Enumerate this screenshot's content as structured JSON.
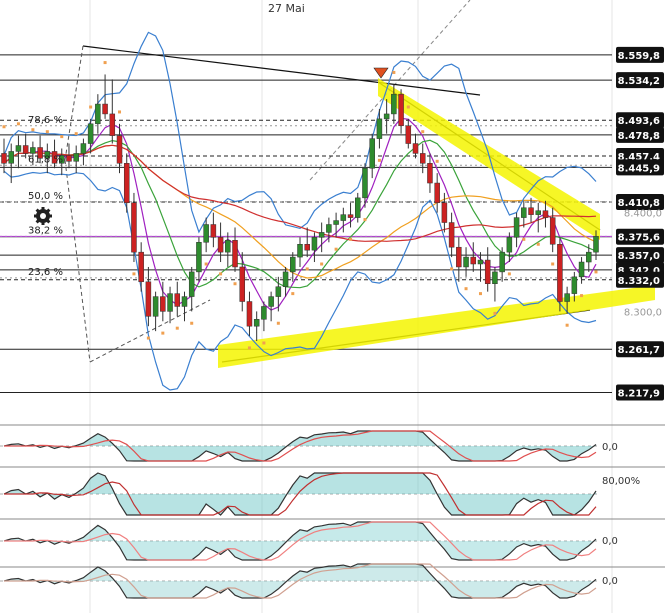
{
  "chart_data": {
    "type": "candlestick",
    "x_label_top": "27 Mai",
    "price_range": [
      8190,
      8585
    ],
    "price_ticks": [
      {
        "label": "8.559,8",
        "value": 8559.8,
        "style": "solid"
      },
      {
        "label": "8.534,2",
        "value": 8534.2,
        "style": "solid"
      },
      {
        "label": "8.493,6",
        "value": 8493.6,
        "style": "dashed"
      },
      {
        "label": "8.478,8",
        "value": 8478.8,
        "style": "solid"
      },
      {
        "label": "8.457,4",
        "value": 8457.4,
        "style": "dashed"
      },
      {
        "label": "8.445,9",
        "value": 8445.9,
        "style": "solid"
      },
      {
        "label": "8.410,8",
        "value": 8410.8,
        "style": "dashed"
      },
      {
        "label": "8.375,6",
        "value": 8375.6,
        "style": "solid"
      },
      {
        "label": "8.357,0",
        "value": 8357.0,
        "style": "solid"
      },
      {
        "label": "8.342,0",
        "value": 8342.0,
        "style": "solid"
      },
      {
        "label": "8.332,0",
        "value": 8332.0,
        "style": "dashed"
      },
      {
        "label": "8.261,7",
        "value": 8261.7,
        "style": "solid"
      },
      {
        "label": "8.217,9",
        "value": 8217.9,
        "style": "solid"
      }
    ],
    "axis_labels": [
      {
        "label": "8.400,0",
        "value": 8400
      },
      {
        "label": "8.300,0",
        "value": 8300
      }
    ],
    "fib_labels": [
      {
        "label": "78,6 %",
        "value": 8488
      },
      {
        "label": "61,8 %",
        "value": 8448
      },
      {
        "label": "50,0 %",
        "value": 8411
      },
      {
        "label": "38,2 %",
        "value": 8376
      },
      {
        "label": "23,6 %",
        "value": 8334
      }
    ],
    "candles_ohlc": [
      [
        8460,
        8475,
        8440,
        8450
      ],
      [
        8450,
        8470,
        8430,
        8462
      ],
      [
        8462,
        8478,
        8445,
        8468
      ],
      [
        8468,
        8480,
        8455,
        8460
      ],
      [
        8460,
        8472,
        8448,
        8466
      ],
      [
        8466,
        8478,
        8450,
        8455
      ],
      [
        8455,
        8470,
        8440,
        8462
      ],
      [
        8462,
        8474,
        8445,
        8450
      ],
      [
        8450,
        8465,
        8438,
        8458
      ],
      [
        8458,
        8470,
        8445,
        8452
      ],
      [
        8452,
        8468,
        8440,
        8460
      ],
      [
        8460,
        8475,
        8448,
        8470
      ],
      [
        8470,
        8495,
        8460,
        8490
      ],
      [
        8490,
        8520,
        8480,
        8510
      ],
      [
        8510,
        8540,
        8495,
        8500
      ],
      [
        8500,
        8535,
        8470,
        8478
      ],
      [
        8478,
        8490,
        8440,
        8450
      ],
      [
        8450,
        8460,
        8400,
        8410
      ],
      [
        8410,
        8420,
        8350,
        8360
      ],
      [
        8360,
        8370,
        8320,
        8330
      ],
      [
        8330,
        8345,
        8285,
        8295
      ],
      [
        8295,
        8320,
        8280,
        8315
      ],
      [
        8315,
        8330,
        8290,
        8300
      ],
      [
        8300,
        8325,
        8288,
        8318
      ],
      [
        8318,
        8330,
        8295,
        8305
      ],
      [
        8305,
        8320,
        8290,
        8315
      ],
      [
        8315,
        8345,
        8300,
        8340
      ],
      [
        8340,
        8375,
        8330,
        8370
      ],
      [
        8370,
        8395,
        8360,
        8388
      ],
      [
        8388,
        8400,
        8365,
        8375
      ],
      [
        8375,
        8390,
        8350,
        8360
      ],
      [
        8360,
        8380,
        8345,
        8372
      ],
      [
        8372,
        8385,
        8340,
        8345
      ],
      [
        8345,
        8360,
        8300,
        8310
      ],
      [
        8310,
        8320,
        8275,
        8285
      ],
      [
        8285,
        8300,
        8270,
        8292
      ],
      [
        8292,
        8310,
        8280,
        8305
      ],
      [
        8305,
        8320,
        8290,
        8315
      ],
      [
        8315,
        8335,
        8300,
        8325
      ],
      [
        8325,
        8345,
        8315,
        8340
      ],
      [
        8340,
        8360,
        8330,
        8355
      ],
      [
        8355,
        8375,
        8345,
        8368
      ],
      [
        8368,
        8385,
        8355,
        8362
      ],
      [
        8362,
        8380,
        8350,
        8375
      ],
      [
        8375,
        8390,
        8360,
        8380
      ],
      [
        8380,
        8395,
        8370,
        8388
      ],
      [
        8388,
        8400,
        8375,
        8392
      ],
      [
        8392,
        8405,
        8380,
        8398
      ],
      [
        8398,
        8410,
        8385,
        8395
      ],
      [
        8395,
        8420,
        8390,
        8415
      ],
      [
        8415,
        8450,
        8405,
        8445
      ],
      [
        8445,
        8480,
        8435,
        8475
      ],
      [
        8475,
        8505,
        8465,
        8495
      ],
      [
        8495,
        8515,
        8480,
        8500
      ],
      [
        8500,
        8530,
        8490,
        8520
      ],
      [
        8520,
        8525,
        8480,
        8488
      ],
      [
        8488,
        8495,
        8465,
        8470
      ],
      [
        8470,
        8480,
        8455,
        8460
      ],
      [
        8460,
        8470,
        8440,
        8450
      ],
      [
        8450,
        8460,
        8420,
        8430
      ],
      [
        8430,
        8440,
        8400,
        8410
      ],
      [
        8410,
        8420,
        8380,
        8390
      ],
      [
        8390,
        8400,
        8355,
        8365
      ],
      [
        8365,
        8375,
        8330,
        8345
      ],
      [
        8345,
        8365,
        8335,
        8355
      ],
      [
        8355,
        8370,
        8340,
        8348
      ],
      [
        8348,
        8360,
        8330,
        8352
      ],
      [
        8352,
        8365,
        8320,
        8328
      ],
      [
        8328,
        8345,
        8310,
        8340
      ],
      [
        8340,
        8365,
        8330,
        8360
      ],
      [
        8360,
        8380,
        8350,
        8375
      ],
      [
        8375,
        8400,
        8365,
        8395
      ],
      [
        8395,
        8412,
        8385,
        8405
      ],
      [
        8405,
        8415,
        8390,
        8398
      ],
      [
        8398,
        8410,
        8380,
        8402
      ],
      [
        8402,
        8412,
        8385,
        8395
      ],
      [
        8395,
        8405,
        8360,
        8368
      ],
      [
        8368,
        8375,
        8300,
        8310
      ],
      [
        8310,
        8325,
        8298,
        8318
      ],
      [
        8318,
        8340,
        8310,
        8335
      ],
      [
        8335,
        8355,
        8328,
        8350
      ],
      [
        8350,
        8368,
        8340,
        8360
      ],
      [
        8360,
        8382,
        8352,
        8376
      ]
    ]
  },
  "oscillator_labels": {
    "macd_zero": "0,0",
    "stoch_level": "80,00%",
    "osc3_zero": "0,0",
    "osc4_zero": "0,0"
  },
  "colors": {
    "up": "#2e8b2e",
    "down": "#cc2222",
    "highlight": "#f5f500",
    "tag_bg": "#111111",
    "bollinger": "#3a7fd0",
    "ma_green": "#3aa33a",
    "ma_orange": "#f0a020",
    "ma_red": "#d03030",
    "ma_purple": "#a020c0",
    "parabolic": "#f0a050"
  }
}
